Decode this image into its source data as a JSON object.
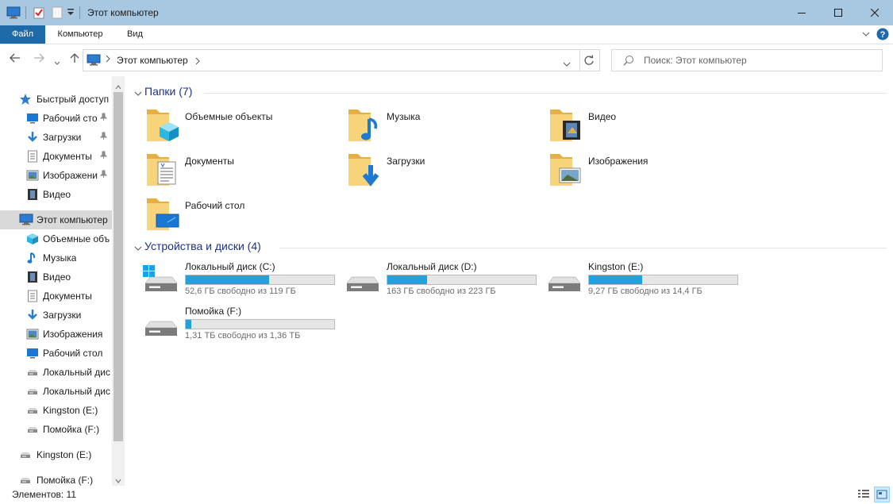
{
  "window": {
    "title": "Этот компьютер"
  },
  "ribbon": {
    "tabs": [
      "Файл",
      "Компьютер",
      "Вид"
    ]
  },
  "address": {
    "path": "Этот компьютер",
    "search_placeholder": "Поиск: Этот компьютер"
  },
  "sidebar": {
    "items": [
      {
        "label": "Быстрый доступ",
        "icon": "star-icon",
        "indent": 0,
        "pinned": false,
        "selected": false
      },
      {
        "label": "Рабочий сто…",
        "icon": "desktop-icon",
        "indent": 1,
        "pinned": true,
        "selected": false
      },
      {
        "label": "Загрузки",
        "icon": "download-icon",
        "indent": 1,
        "pinned": true,
        "selected": false
      },
      {
        "label": "Документы",
        "icon": "document-icon",
        "indent": 1,
        "pinned": true,
        "selected": false
      },
      {
        "label": "Изображени",
        "icon": "picture-icon",
        "indent": 1,
        "pinned": true,
        "selected": false
      },
      {
        "label": "Видео",
        "icon": "video-icon",
        "indent": 1,
        "pinned": false,
        "selected": false
      },
      {
        "label": "Этот компьютер",
        "icon": "computer-icon",
        "indent": 0,
        "pinned": false,
        "selected": true
      },
      {
        "label": "Объемные объ",
        "icon": "cube-icon",
        "indent": 1,
        "pinned": false,
        "selected": false
      },
      {
        "label": "Музыка",
        "icon": "music-icon",
        "indent": 1,
        "pinned": false,
        "selected": false
      },
      {
        "label": "Видео",
        "icon": "video-icon",
        "indent": 1,
        "pinned": false,
        "selected": false
      },
      {
        "label": "Документы",
        "icon": "document-icon",
        "indent": 1,
        "pinned": false,
        "selected": false
      },
      {
        "label": "Загрузки",
        "icon": "download-icon",
        "indent": 1,
        "pinned": false,
        "selected": false
      },
      {
        "label": "Изображения",
        "icon": "picture-icon",
        "indent": 1,
        "pinned": false,
        "selected": false
      },
      {
        "label": "Рабочий стол",
        "icon": "desktop-icon",
        "indent": 1,
        "pinned": false,
        "selected": false
      },
      {
        "label": "Локальный дис",
        "icon": "drive-icon",
        "indent": 1,
        "pinned": false,
        "selected": false
      },
      {
        "label": "Локальный дис",
        "icon": "drive-icon",
        "indent": 1,
        "pinned": false,
        "selected": false
      },
      {
        "label": "Kingston (E:)",
        "icon": "drive-icon",
        "indent": 1,
        "pinned": false,
        "selected": false
      },
      {
        "label": "Помойка (F:)",
        "icon": "drive-icon",
        "indent": 1,
        "pinned": false,
        "selected": false
      },
      {
        "label": "Kingston (E:)",
        "icon": "drive-icon",
        "indent": 0,
        "pinned": false,
        "selected": false
      },
      {
        "label": "Помойка (F:)",
        "icon": "drive-icon",
        "indent": 0,
        "pinned": false,
        "selected": false
      }
    ]
  },
  "folders": {
    "header": "Папки (7)",
    "items": [
      {
        "name": "Объемные объекты",
        "icon": "cube-icon"
      },
      {
        "name": "Музыка",
        "icon": "music-icon"
      },
      {
        "name": "Видео",
        "icon": "video-icon"
      },
      {
        "name": "Документы",
        "icon": "document-icon"
      },
      {
        "name": "Загрузки",
        "icon": "download-icon"
      },
      {
        "name": "Изображения",
        "icon": "picture-icon"
      },
      {
        "name": "Рабочий стол",
        "icon": "desktop-icon"
      }
    ]
  },
  "drives": {
    "header": "Устройства и диски (4)",
    "items": [
      {
        "name": "Локальный диск (C:)",
        "info": "52,6 ГБ свободно из 119 ГБ",
        "used_fraction": 0.56,
        "system": true
      },
      {
        "name": "Локальный диск (D:)",
        "info": "163 ГБ свободно из 223 ГБ",
        "used_fraction": 0.27,
        "system": false
      },
      {
        "name": "Kingston (E:)",
        "info": "9,27 ГБ свободно из 14,4 ГБ",
        "used_fraction": 0.36,
        "system": false
      },
      {
        "name": "Помойка (F:)",
        "info": "1,31 ТБ свободно из 1,36 ТБ",
        "used_fraction": 0.04,
        "system": false
      }
    ]
  },
  "status": {
    "text": "Элементов: 11"
  },
  "colors": {
    "accent": "#1e6aa8",
    "bar_fill": "#26a0da",
    "folder": "#f3c860",
    "header_text": "#1e3287"
  }
}
